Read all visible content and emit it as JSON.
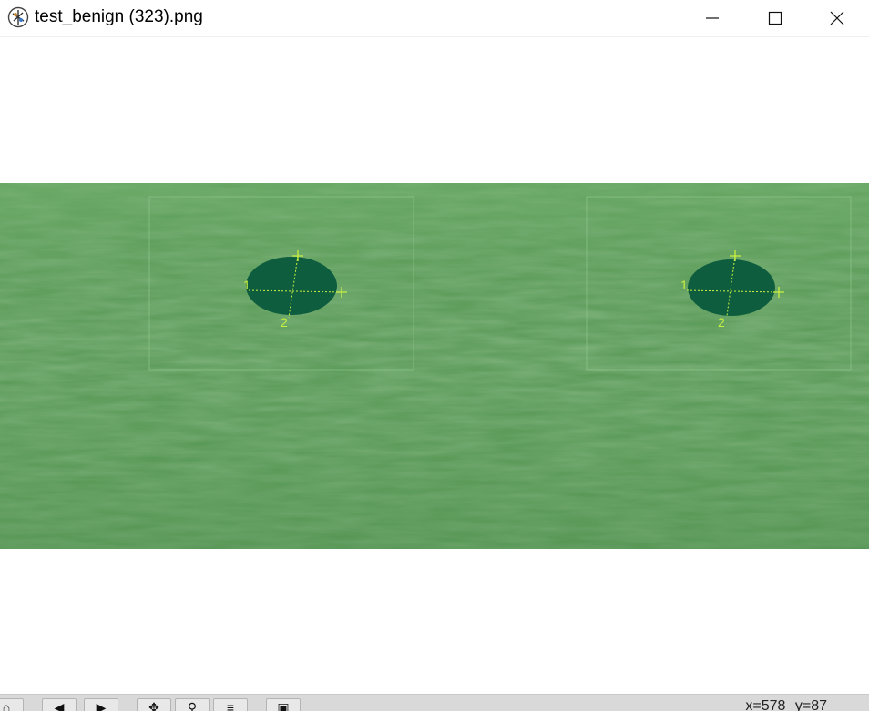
{
  "window": {
    "title": "test_benign (323).png",
    "app_icon": "image-viewer-icon",
    "controls": [
      "minimize-icon",
      "maximize-icon",
      "close-icon"
    ]
  },
  "toolbar": {
    "buttons": [
      {
        "name": "home-button",
        "icon": "home-icon",
        "glyph": "⌂"
      },
      {
        "name": "back-button",
        "icon": "back-arrow-icon",
        "glyph": "◀"
      },
      {
        "name": "forward-button",
        "icon": "forward-arrow-icon",
        "glyph": "▶"
      },
      {
        "name": "pan-button",
        "icon": "move-icon",
        "glyph": "✥"
      },
      {
        "name": "zoom-button",
        "icon": "zoom-icon",
        "glyph": "⚲"
      },
      {
        "name": "configure-button",
        "icon": "sliders-icon",
        "glyph": "≡"
      },
      {
        "name": "save-button",
        "icon": "save-icon",
        "glyph": "▣"
      }
    ]
  },
  "status": {
    "x_readout": "x=578",
    "y_readout": "y=87"
  },
  "image": {
    "background_color": "#5a9a58",
    "lesion_color": "#0e5d3f",
    "marker_color": "#c8f040",
    "marker_labels": [
      "1",
      "2"
    ]
  }
}
